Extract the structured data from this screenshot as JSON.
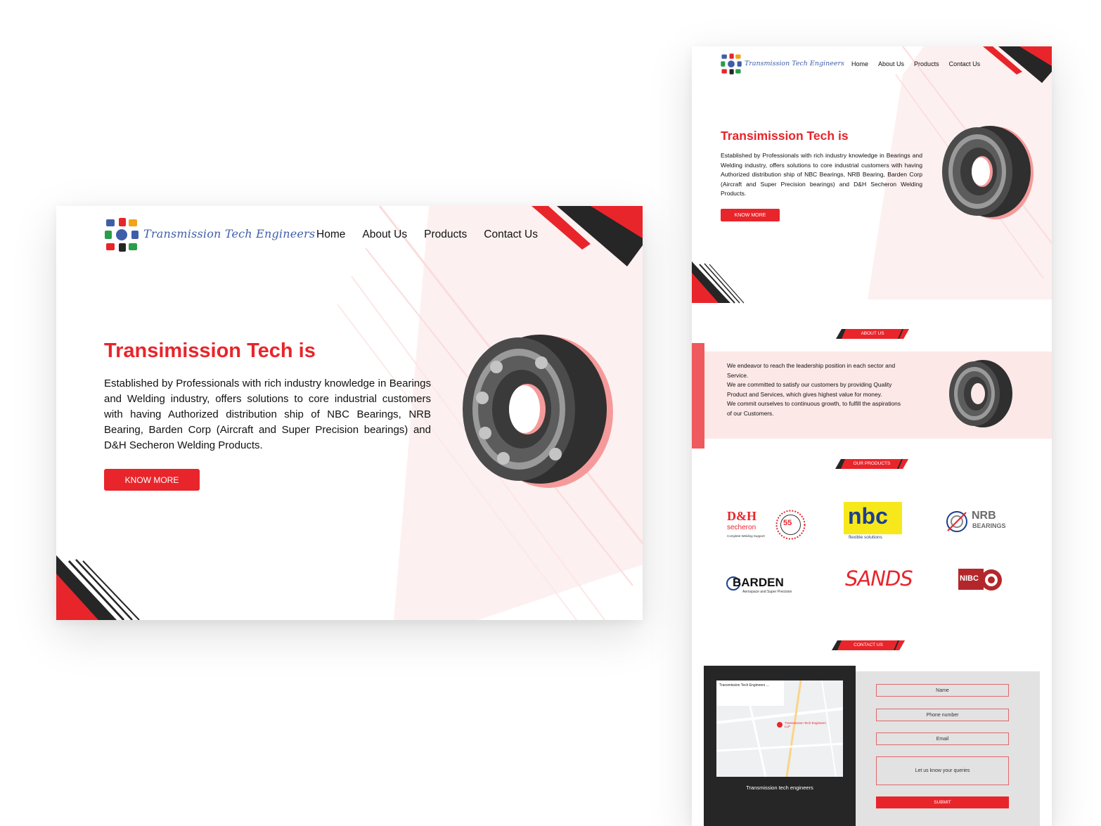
{
  "colors": {
    "accent": "#e8252b",
    "dark": "#262626",
    "pink_bg": "#fdf0f0",
    "logo_text": "#3f5ea8"
  },
  "brand": {
    "name": "Transmission Tech Engineers"
  },
  "nav": {
    "home": "Home",
    "about": "About Us",
    "products": "Products",
    "contact": "Contact Us"
  },
  "hero": {
    "title": "Transimission Tech is",
    "description": "Established by Professionals with rich industry knowledge in Bearings and Welding industry, offers solutions to core industrial customers with having Authorized distribution ship of NBC Bearings, NRB Bearing, Barden Corp (Aircraft and Super Precision bearings) and D&H Secheron Welding Products.",
    "button": "KNOW MORE"
  },
  "about": {
    "tag": "ABOUT US",
    "lines": [
      "We endeavor to reach the leadership position in each sector and Service.",
      "We are committed to satisfy our customers by providing Quality Product and Services, which gives highest value for money.",
      "We commit ourselves to continuous growth, to fulfill the aspirations of our Customers."
    ]
  },
  "products": {
    "tag": "OUR PRODUCTS",
    "brands": {
      "dh": {
        "name": "D&H",
        "sub": "secheron",
        "tagline": "Complete Welding Support",
        "badge": "55"
      },
      "nbc": {
        "name": "nbc",
        "tagline": "flexible solutions"
      },
      "nrb": {
        "name": "NRB",
        "sub": "BEARINGS"
      },
      "barden": {
        "name": "BARDEN",
        "tagline": "Aerospace and Super Precision"
      },
      "sands": {
        "name": "SANDS"
      },
      "nibc": {
        "name": "NIBC"
      }
    }
  },
  "contact": {
    "tag": "CONTACT US",
    "map_caption": "Transmission tech engineers",
    "map_title": "Transmission Tech Engineers ...",
    "map_pin": "Transmission Tech Engineers LLP",
    "fields": {
      "name": "Name",
      "phone": "Phone number",
      "email": "Email",
      "query": "Let us know your queries"
    },
    "submit": "SUBMIT"
  }
}
